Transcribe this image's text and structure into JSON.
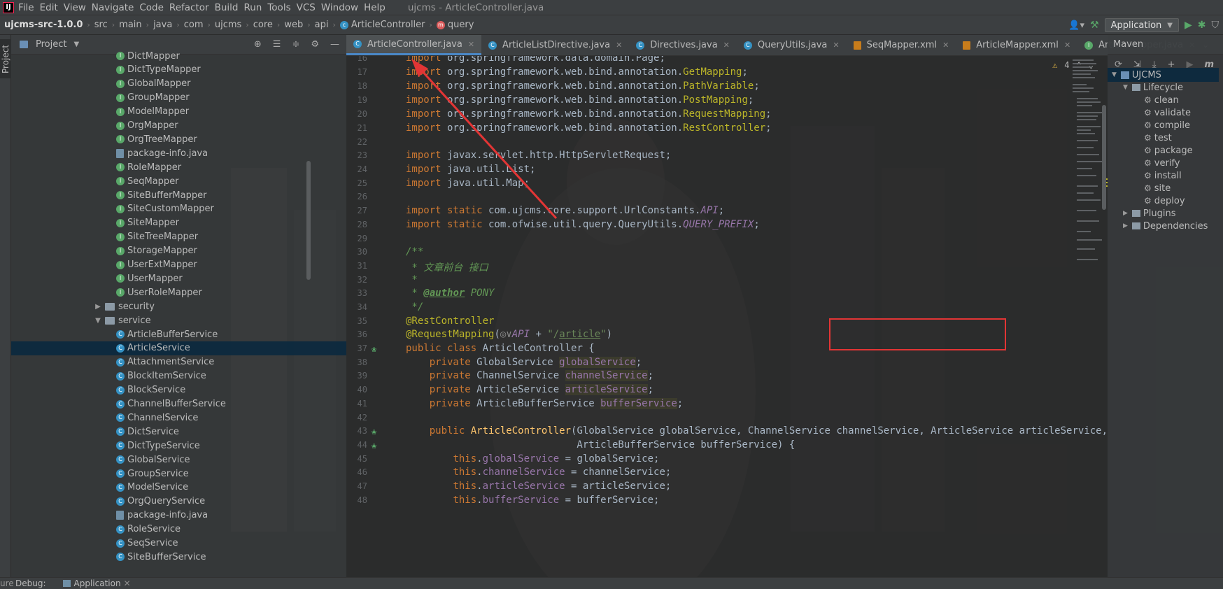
{
  "menubar": {
    "items": [
      "File",
      "Edit",
      "View",
      "Navigate",
      "Code",
      "Refactor",
      "Build",
      "Run",
      "Tools",
      "VCS",
      "Window",
      "Help"
    ],
    "window_title": "ujcms - ArticleController.java"
  },
  "breadcrumb": {
    "project": "ujcms-src-1.0.0",
    "parts": [
      "src",
      "main",
      "java",
      "com",
      "ujcms",
      "core",
      "web",
      "api"
    ],
    "class_name": "ArticleController",
    "method_name": "query"
  },
  "run_config": {
    "label": "Application"
  },
  "left_stripe": {
    "project_tab": "Project"
  },
  "project_panel": {
    "title": "Project",
    "items": [
      {
        "label": "DictMapper",
        "type": "iface"
      },
      {
        "label": "DictTypeMapper",
        "type": "iface"
      },
      {
        "label": "GlobalMapper",
        "type": "iface"
      },
      {
        "label": "GroupMapper",
        "type": "iface"
      },
      {
        "label": "ModelMapper",
        "type": "iface"
      },
      {
        "label": "OrgMapper",
        "type": "iface"
      },
      {
        "label": "OrgTreeMapper",
        "type": "iface"
      },
      {
        "label": "package-info.java",
        "type": "file"
      },
      {
        "label": "RoleMapper",
        "type": "iface"
      },
      {
        "label": "SeqMapper",
        "type": "iface"
      },
      {
        "label": "SiteBufferMapper",
        "type": "iface"
      },
      {
        "label": "SiteCustomMapper",
        "type": "iface"
      },
      {
        "label": "SiteMapper",
        "type": "iface"
      },
      {
        "label": "SiteTreeMapper",
        "type": "iface"
      },
      {
        "label": "StorageMapper",
        "type": "iface"
      },
      {
        "label": "UserExtMapper",
        "type": "iface"
      },
      {
        "label": "UserMapper",
        "type": "iface"
      },
      {
        "label": "UserRoleMapper",
        "type": "iface"
      },
      {
        "label": "security",
        "type": "folder-collapsed"
      },
      {
        "label": "service",
        "type": "folder-open"
      },
      {
        "label": "ArticleBufferService",
        "type": "class"
      },
      {
        "label": "ArticleService",
        "type": "class",
        "selected": true
      },
      {
        "label": "AttachmentService",
        "type": "class"
      },
      {
        "label": "BlockItemService",
        "type": "class"
      },
      {
        "label": "BlockService",
        "type": "class"
      },
      {
        "label": "ChannelBufferService",
        "type": "class"
      },
      {
        "label": "ChannelService",
        "type": "class"
      },
      {
        "label": "DictService",
        "type": "class"
      },
      {
        "label": "DictTypeService",
        "type": "class"
      },
      {
        "label": "GlobalService",
        "type": "class"
      },
      {
        "label": "GroupService",
        "type": "class"
      },
      {
        "label": "ModelService",
        "type": "class"
      },
      {
        "label": "OrgQueryService",
        "type": "class"
      },
      {
        "label": "package-info.java",
        "type": "file"
      },
      {
        "label": "RoleService",
        "type": "class"
      },
      {
        "label": "SeqService",
        "type": "class"
      },
      {
        "label": "SiteBufferService",
        "type": "class"
      }
    ]
  },
  "editor_tabs": [
    {
      "label": "ArticleController.java",
      "icon": "class",
      "active": true
    },
    {
      "label": "ArticleListDirective.java",
      "icon": "class"
    },
    {
      "label": "Directives.java",
      "icon": "class"
    },
    {
      "label": "QueryUtils.java",
      "icon": "class"
    },
    {
      "label": "SeqMapper.xml",
      "icon": "xml"
    },
    {
      "label": "ArticleMapper.xml",
      "icon": "xml"
    },
    {
      "label": "ArticleMapper.java",
      "icon": "iface"
    }
  ],
  "editor": {
    "warning_count": "4",
    "line_numbers": [
      "16",
      "17",
      "18",
      "19",
      "20",
      "21",
      "22",
      "23",
      "24",
      "25",
      "26",
      "27",
      "28",
      "29",
      "30",
      "31",
      "32",
      "33",
      "34",
      "35",
      "36",
      "37",
      "38",
      "39",
      "40",
      "41",
      "42",
      "43",
      "44",
      "45",
      "46",
      "47",
      "48"
    ]
  },
  "maven_panel": {
    "title": "Maven",
    "project": "UJCMS",
    "lifecycle": "Lifecycle",
    "phases": [
      "clean",
      "validate",
      "compile",
      "test",
      "package",
      "verify",
      "install",
      "site",
      "deploy"
    ],
    "plugins": "Plugins",
    "dependencies": "Dependencies"
  },
  "bottombar": {
    "debug_label": "Debug:",
    "app_tab": "Application"
  },
  "colors": {
    "keyword": "#cc7832",
    "annotation": "#bbb529",
    "string": "#6a8759",
    "field": "#9876aa",
    "comment": "#629755",
    "highlight_box": "#e23535",
    "selection": "#0d293e"
  }
}
